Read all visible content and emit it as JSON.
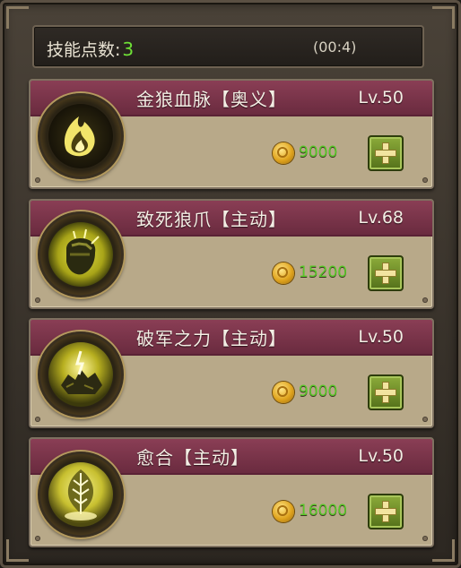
{
  "header": {
    "skill_points_label": "技能点数:",
    "skill_points_value": "3",
    "timer": "(00:4)"
  },
  "skills": [
    {
      "name": "金狼血脉【奥义】",
      "level": "Lv.50",
      "cost": "9000",
      "icon": "golden-flame-icon"
    },
    {
      "name": "致死狼爪【主动】",
      "level": "Lv.68",
      "cost": "15200",
      "icon": "clenched-claw-icon"
    },
    {
      "name": "破军之力【主动】",
      "level": "Lv.50",
      "cost": "9000",
      "icon": "shattered-rock-icon"
    },
    {
      "name": "愈合【主动】",
      "level": "Lv.50",
      "cost": "16000",
      "icon": "healing-leaf-icon"
    }
  ],
  "colors": {
    "band": "#7a3349",
    "cost_text": "#58c728",
    "points_value": "#6ee036",
    "upgrade_button": "#6e8c28"
  }
}
